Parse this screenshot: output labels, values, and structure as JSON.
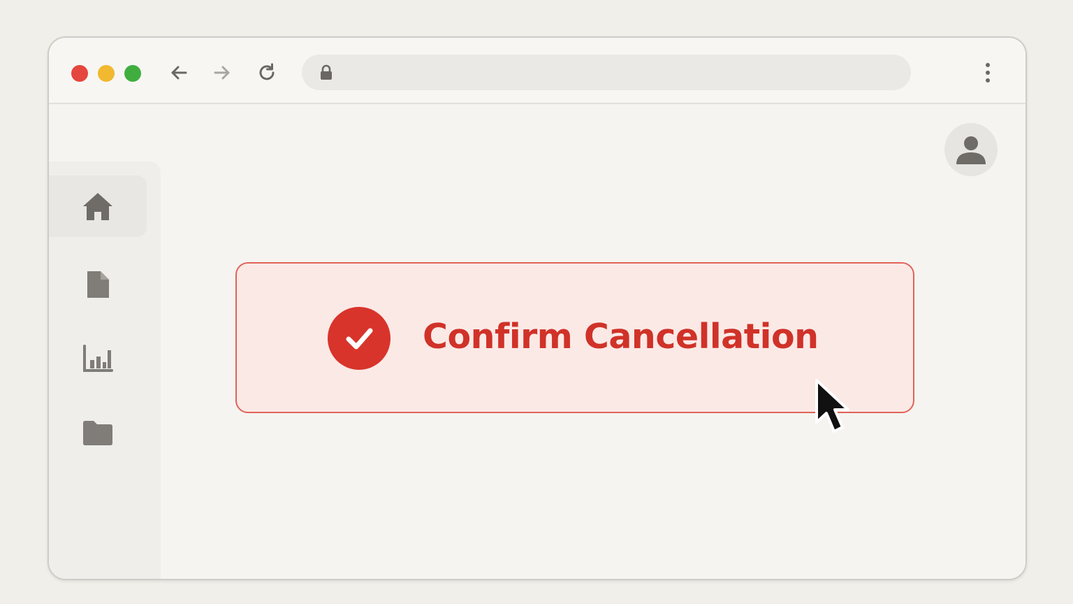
{
  "browser": {
    "window_controls": [
      "close",
      "minimize",
      "maximize"
    ],
    "nav": {
      "back_icon": "arrow-left-icon",
      "forward_icon": "arrow-right-icon",
      "reload_icon": "reload-icon"
    },
    "address_bar": {
      "value": "",
      "icon": "lock-icon"
    },
    "menu_icon": "vertical-dots-icon"
  },
  "sidebar": {
    "items": [
      {
        "icon": "home-icon",
        "active": true
      },
      {
        "icon": "document-icon",
        "active": false
      },
      {
        "icon": "chart-icon",
        "active": false
      },
      {
        "icon": "folder-icon",
        "active": false
      }
    ]
  },
  "header": {
    "avatar_icon": "user-icon"
  },
  "main": {
    "confirm_button": {
      "label": "Confirm Cancellation",
      "icon": "check-circle-icon"
    }
  },
  "colors": {
    "accent_red": "#d03228",
    "button_bg": "#fbe9e6",
    "button_border": "#e06358",
    "traffic_red": "#e5463d",
    "traffic_yellow": "#f1b830",
    "traffic_green": "#3fae3f"
  }
}
